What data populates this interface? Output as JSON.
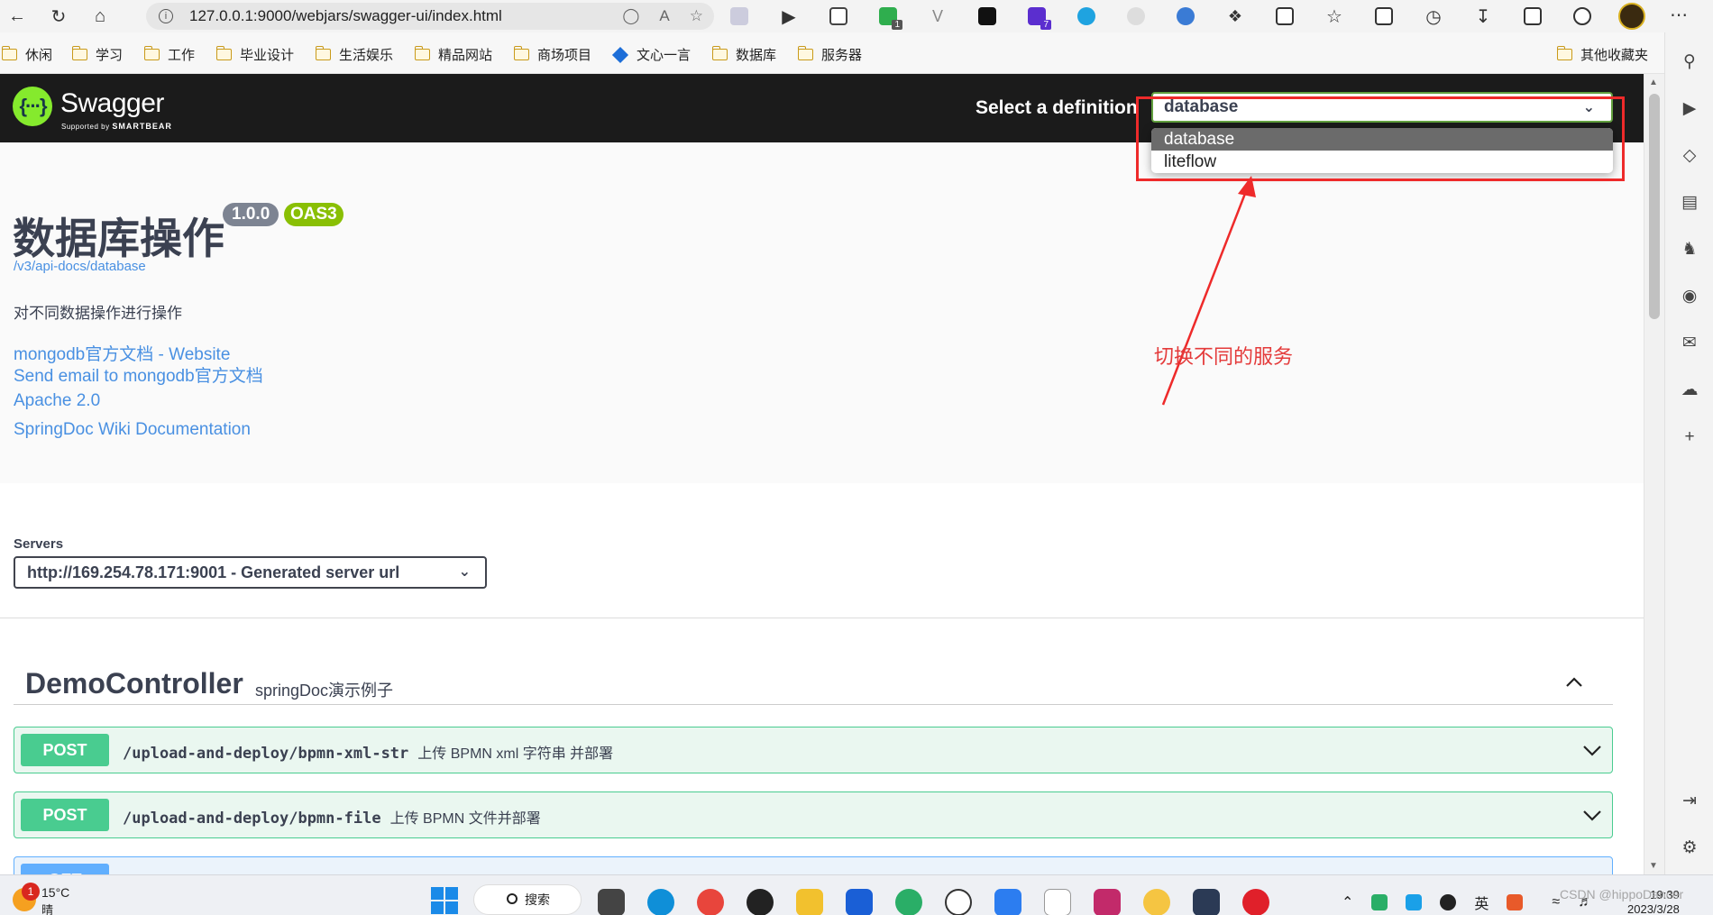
{
  "browser": {
    "url": "127.0.0.1:9000/webjars/swagger-ui/index.html",
    "ext_badges": [
      "1",
      "7"
    ],
    "bookmarks": [
      {
        "label": "休闲"
      },
      {
        "label": "学习"
      },
      {
        "label": "工作"
      },
      {
        "label": "毕业设计"
      },
      {
        "label": "生活娱乐"
      },
      {
        "label": "精品网站"
      },
      {
        "label": "商场项目"
      },
      {
        "label": "文心一言"
      },
      {
        "label": "数据库"
      },
      {
        "label": "服务器"
      }
    ],
    "other_bookmarks": "其他收藏夹"
  },
  "swagger": {
    "logo_text": "Swagger",
    "logo_sub_prefix": "Supported by",
    "logo_sub_brand": "SMARTBEAR",
    "definition_label": "Select a definition",
    "selected_definition": "database",
    "definition_options": [
      "database",
      "liteflow"
    ]
  },
  "annotation": {
    "text": "切换不同的服务",
    "color": "#e43a3a"
  },
  "info": {
    "title": "数据库操作",
    "version": "1.0.0",
    "oas": "OAS3",
    "doc_url": "/v3/api-docs/database",
    "description": "对不同数据操作进行操作",
    "links": [
      "mongodb官方文档 - Website",
      "Send email to mongodb官方文档",
      "Apache 2.0",
      "SpringDoc Wiki Documentation"
    ]
  },
  "servers": {
    "label": "Servers",
    "selected": "http://169.254.78.171:9001 - Generated server url"
  },
  "tag": {
    "name": "DemoController",
    "description": "springDoc演示例子"
  },
  "operations": [
    {
      "method": "POST",
      "path": "/upload-and-deploy/bpmn-xml-str",
      "summary": "上传 BPMN xml 字符串 并部署"
    },
    {
      "method": "POST",
      "path": "/upload-and-deploy/bpmn-file",
      "summary": "上传 BPMN 文件并部署"
    },
    {
      "method": "GET",
      "path": "",
      "summary": ""
    }
  ],
  "taskbar": {
    "notification_count": "1",
    "temperature": "15°C",
    "weather": "晴朗",
    "search": "搜索",
    "ime": "英",
    "time": "19:39",
    "date": "2023/3/28"
  },
  "watermark": "CSDN @hippoDancer",
  "colors": {
    "post": "#49cc90",
    "get": "#61affe",
    "swagger_green": "#85ea2d",
    "link": "#4990e2"
  }
}
